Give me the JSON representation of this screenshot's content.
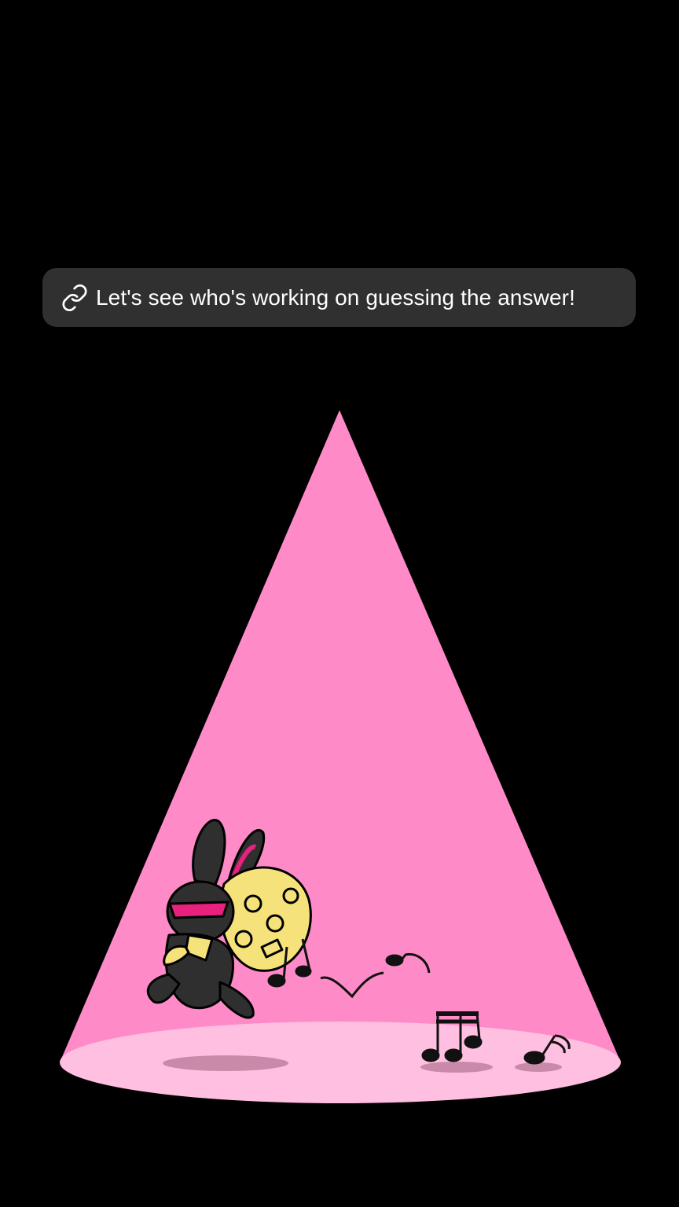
{
  "toast": {
    "icon": "link-icon",
    "message": "Let's see who's working on guessing the answer!"
  },
  "colors": {
    "background": "#000000",
    "toast_background": "#303030",
    "toast_text": "#ffffff",
    "spotlight": "#ff8ac8",
    "stage_floor": "#ffbfe0",
    "shadow": "#c98aa9",
    "bunny": "#2f2f2f",
    "bunny_accent": "#e8207e",
    "money_bag": "#f6e27a",
    "notes": "#111111"
  },
  "illustration": {
    "subject": "bunny-thief-icon",
    "props": [
      "money-bag-icon",
      "music-note-icon"
    ]
  }
}
